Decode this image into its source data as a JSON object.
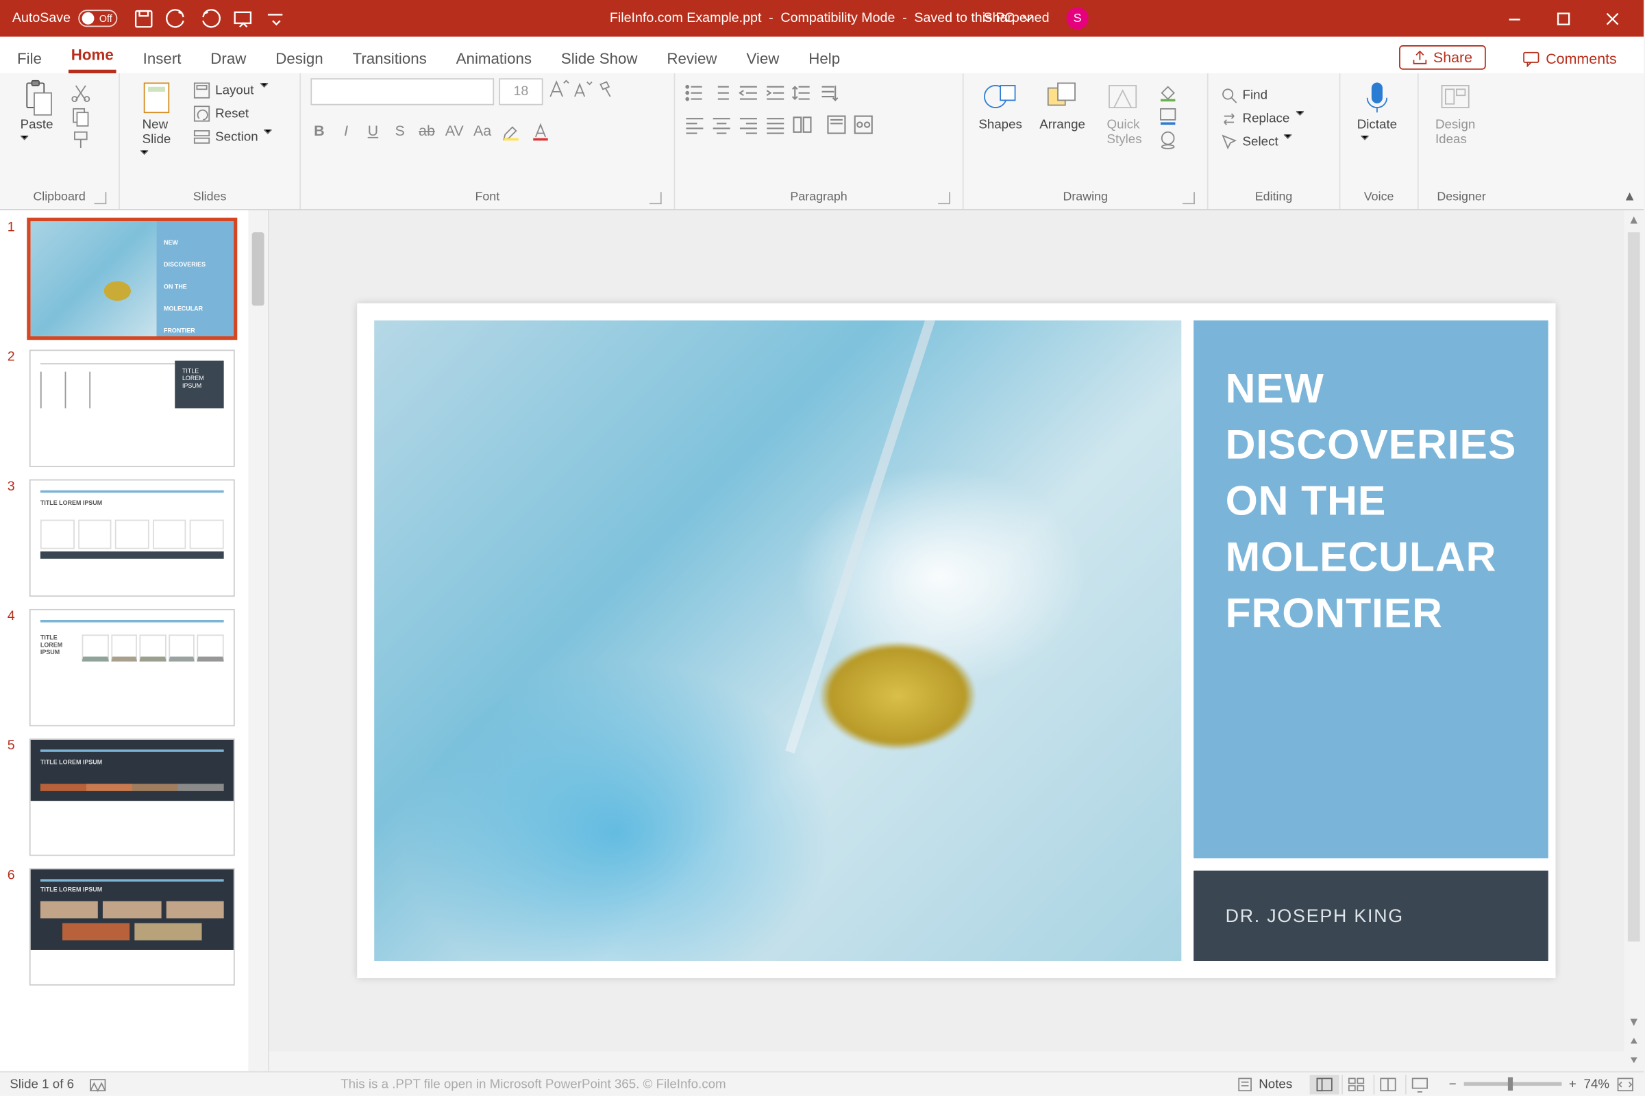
{
  "titlebar": {
    "autosave_label": "AutoSave",
    "autosave_state": "Off",
    "filename": "FileInfo.com Example.ppt",
    "mode": "Compatibility Mode",
    "saved": "Saved to this PC",
    "username": "Sharpened",
    "avatar_initial": "S"
  },
  "tabs": [
    "File",
    "Home",
    "Insert",
    "Draw",
    "Design",
    "Transitions",
    "Animations",
    "Slide Show",
    "Review",
    "View",
    "Help"
  ],
  "tabs_active_index": 1,
  "share_label": "Share",
  "comments_label": "Comments",
  "ribbon": {
    "clipboard": {
      "paste": "Paste",
      "label": "Clipboard"
    },
    "slides": {
      "newslide": "New\nSlide",
      "layout": "Layout",
      "reset": "Reset",
      "section": "Section",
      "label": "Slides"
    },
    "font": {
      "size": "18",
      "label": "Font",
      "buttons": [
        "B",
        "I",
        "U",
        "S",
        "ab",
        "AV",
        "Aa"
      ]
    },
    "paragraph": {
      "label": "Paragraph"
    },
    "drawing": {
      "shapes": "Shapes",
      "arrange": "Arrange",
      "quick": "Quick\nStyles",
      "label": "Drawing"
    },
    "editing": {
      "find": "Find",
      "replace": "Replace",
      "select": "Select",
      "label": "Editing"
    },
    "voice": {
      "dictate": "Dictate",
      "label": "Voice"
    },
    "designer": {
      "ideas": "Design\nIdeas",
      "label": "Designer"
    }
  },
  "thumbnails": [
    {
      "num": "1",
      "title_lines": "NEW\nDISCOVERIES\nON THE\nMOLECULAR\nFRONTIER",
      "selected": true
    },
    {
      "num": "2",
      "title": "TITLE LOREM IPSUM"
    },
    {
      "num": "3",
      "title": "TITLE LOREM IPSUM"
    },
    {
      "num": "4",
      "title": "TITLE LOREM IPSUM"
    },
    {
      "num": "5",
      "title": "TITLE LOREM IPSUM"
    },
    {
      "num": "6",
      "title": "TITLE LOREM IPSUM"
    }
  ],
  "slide": {
    "title": "NEW DISCOVERIES ON THE MOLECULAR FRONTIER",
    "author": "DR. JOSEPH KING"
  },
  "status": {
    "slide_counter": "Slide 1 of 6",
    "watermark": "This is a .PPT file open in Microsoft PowerPoint 365. © FileInfo.com",
    "notes": "Notes",
    "zoom": "74%"
  }
}
